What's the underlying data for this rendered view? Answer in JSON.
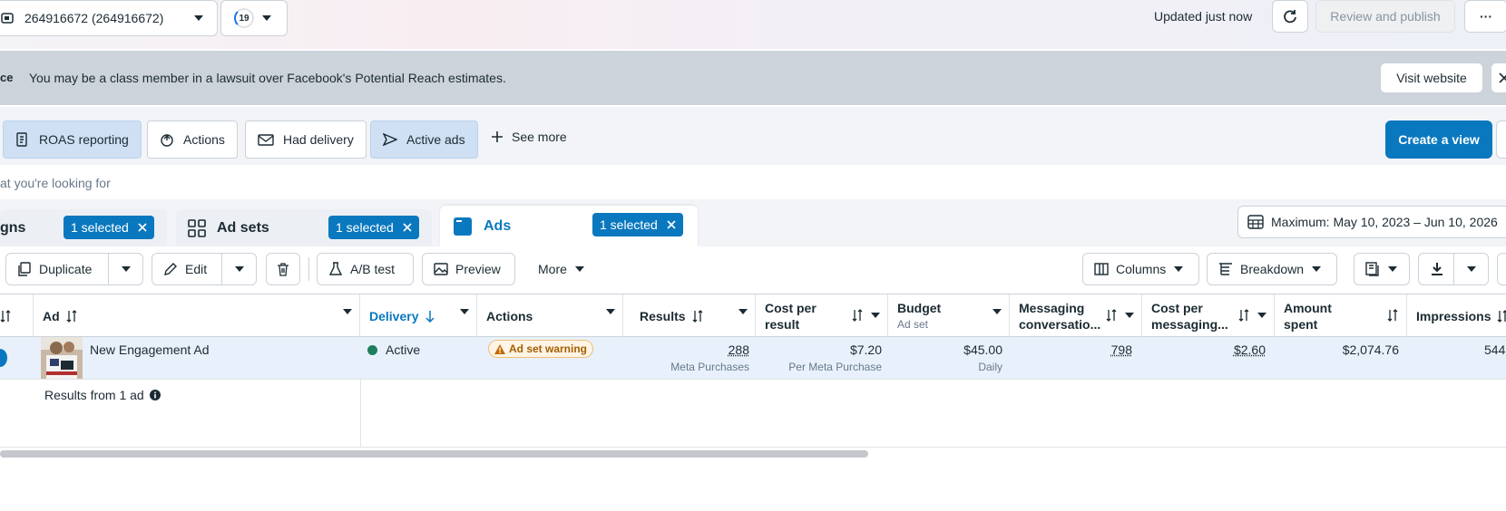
{
  "topbar": {
    "account": "264916672 (264916672)",
    "progress_count": "19",
    "updated": "Updated just now",
    "review_publish": "Review and publish",
    "more": "···"
  },
  "notice": {
    "lead": "ce",
    "message": "You may be a class member in a lawsuit over Facebook's Potential Reach estimates.",
    "visit": "Visit website"
  },
  "views": {
    "items": [
      {
        "label": "ROAS reporting",
        "selected": true
      },
      {
        "label": "Actions",
        "selected": false
      },
      {
        "label": "Had delivery",
        "selected": false
      },
      {
        "label": "Active ads",
        "selected": true
      }
    ],
    "see_more": "See more",
    "create": "Create a view"
  },
  "search": {
    "placeholder": "at you're looking for"
  },
  "tabs": {
    "campaigns": {
      "label": "gns",
      "selected": "1 selected"
    },
    "adsets": {
      "label": "Ad sets",
      "selected": "1 selected"
    },
    "ads": {
      "label": "Ads",
      "selected": "1 selected"
    },
    "date_range": "Maximum: May 10, 2023 – Jun 10, 2026"
  },
  "toolbar": {
    "duplicate": "Duplicate",
    "edit": "Edit",
    "ab_test": "A/B test",
    "preview": "Preview",
    "more": "More",
    "columns": "Columns",
    "breakdown": "Breakdown"
  },
  "table": {
    "headers": {
      "ad": "Ad",
      "delivery": "Delivery",
      "actions": "Actions",
      "results": "Results",
      "cost_per_result_1": "Cost per",
      "cost_per_result_2": "result",
      "budget": "Budget",
      "budget_sub": "Ad set",
      "messaging_1": "Messaging",
      "messaging_2": "conversatio...",
      "cost_msg_1": "Cost per",
      "cost_msg_2": "messaging...",
      "amount_1": "Amount",
      "amount_2": "spent",
      "impressions": "Impressions"
    },
    "row": {
      "ad_name": "New Engagement Ad",
      "delivery": "Active",
      "actions_warning": "Ad set warning",
      "results": "288",
      "results_sub": "Meta Purchases",
      "cost_per_result": "$7.20",
      "cost_per_result_sub": "Per Meta Purchase",
      "budget": "$45.00",
      "budget_sub": "Daily",
      "messaging": "798",
      "cost_per_messaging": "$2.60",
      "amount_spent": "$2,074.76",
      "impressions": "544"
    },
    "summary": "Results from 1 ad"
  },
  "colors": {
    "accent": "#0a78be",
    "active_dot": "#1d7f5f",
    "warning": "#a35e00"
  }
}
